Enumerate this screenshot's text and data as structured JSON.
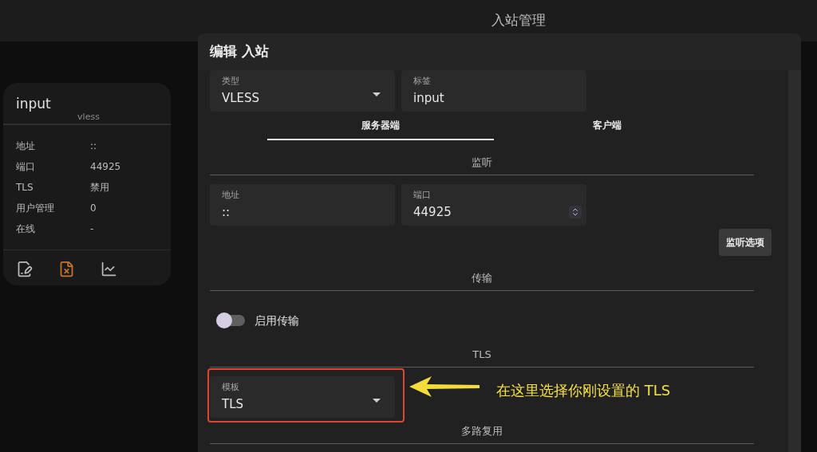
{
  "top_bar": {
    "title": "入站管理"
  },
  "inbound_card": {
    "title": "input",
    "subtitle": "vless",
    "rows": [
      {
        "label": "地址",
        "value": "::"
      },
      {
        "label": "端口",
        "value": "44925"
      },
      {
        "label": "TLS",
        "value": "禁用"
      },
      {
        "label": "用户管理",
        "value": "0"
      },
      {
        "label": "在线",
        "value": "-"
      }
    ]
  },
  "dialog": {
    "title": "编辑 入站",
    "type_field": {
      "label": "类型",
      "value": "VLESS"
    },
    "tag_field": {
      "label": "标签",
      "value": "input"
    },
    "tabs": [
      {
        "label": "服务器端",
        "selected": true
      },
      {
        "label": "客户端",
        "selected": false
      }
    ],
    "listen_section": {
      "heading": "监听",
      "address_field": {
        "label": "地址",
        "value": "::"
      },
      "port_field": {
        "label": "端口",
        "value": "44925"
      },
      "options_button": "监听选项"
    },
    "transport_section": {
      "heading": "传输",
      "toggle": {
        "label": "启用传输",
        "on": false
      }
    },
    "tls_section": {
      "heading": "TLS",
      "template_field": {
        "label": "模板",
        "value": "TLS"
      }
    },
    "mux_section": {
      "heading": "多路复用"
    }
  },
  "annotation": {
    "text": "在这里选择你刚设置的 TLS"
  }
}
